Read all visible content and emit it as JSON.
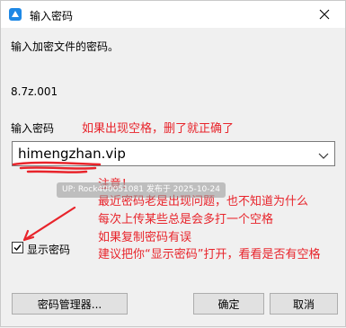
{
  "window": {
    "title": "输入密码"
  },
  "prompt": "输入加密文件的密码。",
  "file_name": "8.7z.001",
  "password": {
    "label": "输入密码",
    "value": "himengzhan.vip"
  },
  "show_password": {
    "label": "显示密码",
    "checked": true
  },
  "buttons": {
    "manager": "密码管理器...",
    "ok": "确定",
    "cancel": "取消"
  },
  "annotations": {
    "top_note": "如果出现空格，删了就正确了",
    "heading": "注意！",
    "lines": [
      "最近密码老是出现问题，也不知道为什么",
      "每次上传某些总是会多打一个空格",
      "如果复制密码有误",
      "建议把你“显示密码”打开，看看是否有空格"
    ]
  },
  "watermark": "UP: Rock400051081 发布于 2025-10-24",
  "colors": {
    "annotation": "#e8242b",
    "app_icon": "#1e88e5"
  }
}
